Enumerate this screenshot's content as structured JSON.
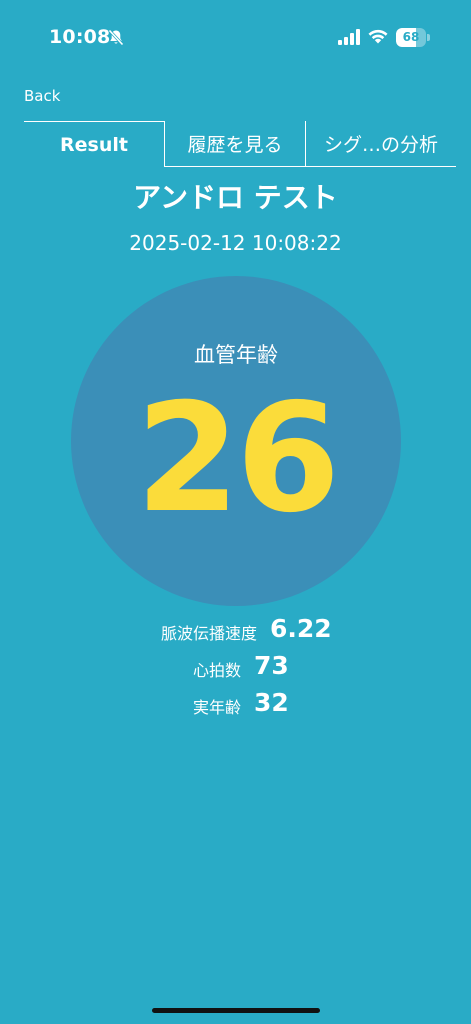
{
  "status_bar": {
    "time": "10:08",
    "battery_level": 68,
    "battery_text": "68"
  },
  "nav": {
    "back_label": "Back"
  },
  "tabs": [
    {
      "label": "Result",
      "active": true
    },
    {
      "label": "履歴を見る",
      "active": false
    },
    {
      "label": "シグ…の分析",
      "active": false
    }
  ],
  "result": {
    "user_name": "アンドロ テスト",
    "timestamp": "2025-02-12 10:08:22",
    "vascular_age_label": "血管年齢",
    "vascular_age_value": "26",
    "metrics": [
      {
        "label": "脈波伝播速度",
        "value": "6.22"
      },
      {
        "label": "心拍数",
        "value": "73"
      },
      {
        "label": "実年齢",
        "value": "32"
      }
    ]
  },
  "colors": {
    "background": "#29abc6",
    "circle": "#3b8fb8",
    "accent_yellow": "#fbdc3a",
    "text": "#ffffff"
  }
}
